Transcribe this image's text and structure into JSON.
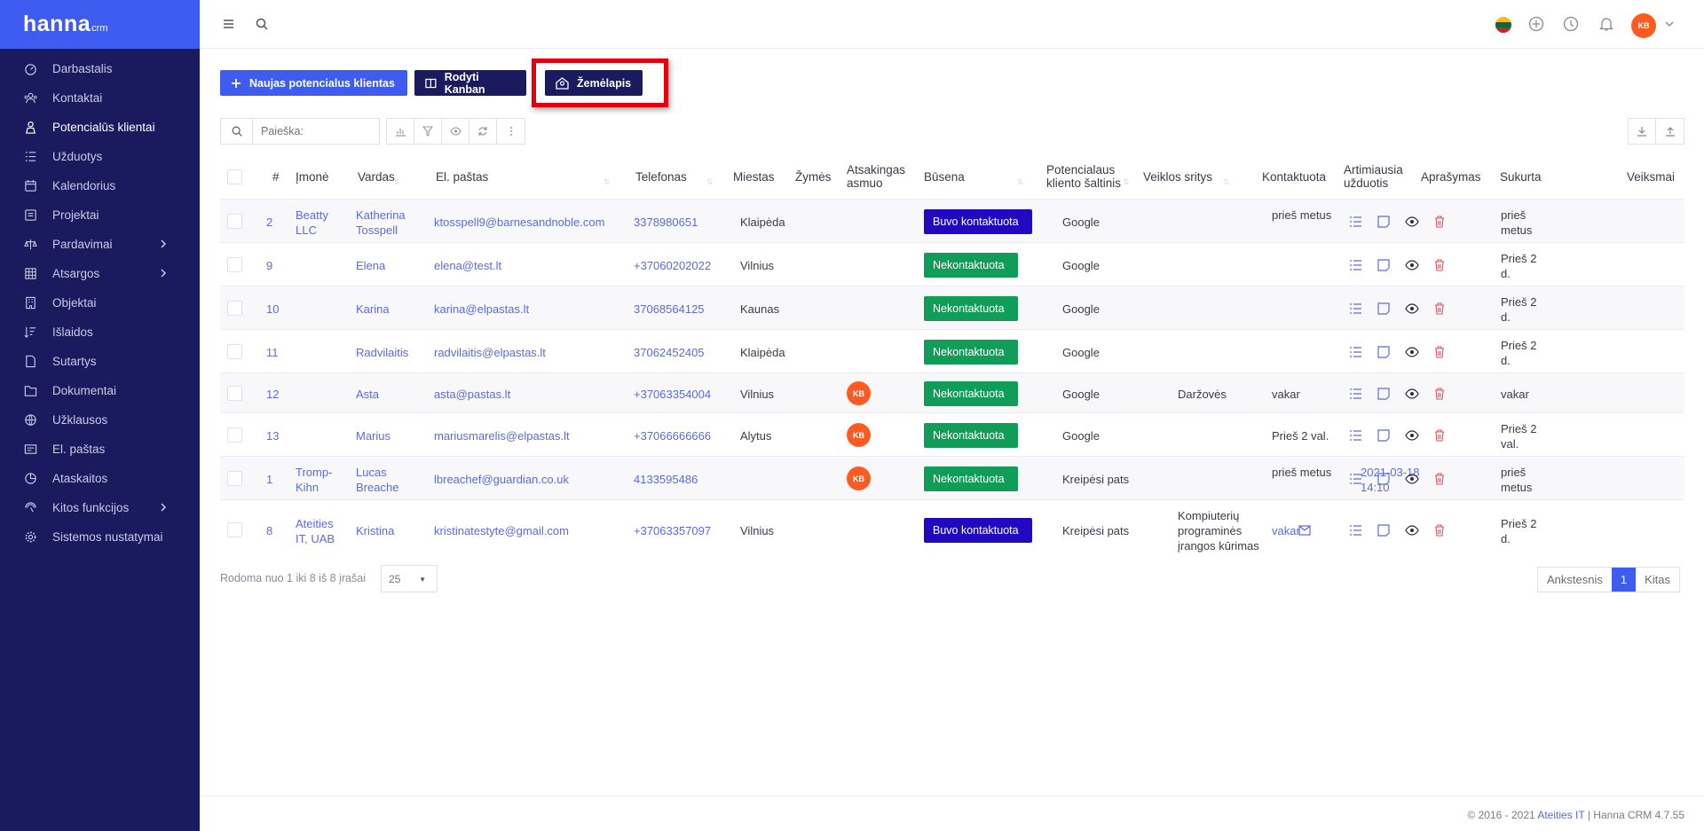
{
  "app": {
    "logo": "hanna",
    "logo_sub": "crm"
  },
  "sidebar": {
    "items": [
      {
        "label": "Darbastalis",
        "icon": "dashboard-icon"
      },
      {
        "label": "Kontaktai",
        "icon": "contacts-icon"
      },
      {
        "label": "Potencialūs klientai",
        "icon": "leads-icon",
        "active": true
      },
      {
        "label": "Užduotys",
        "icon": "tasks-icon"
      },
      {
        "label": "Kalendorius",
        "icon": "calendar-icon"
      },
      {
        "label": "Projektai",
        "icon": "projects-icon"
      },
      {
        "label": "Pardavimai",
        "icon": "sales-icon",
        "has_children": true
      },
      {
        "label": "Atsargos",
        "icon": "inventory-icon",
        "has_children": true
      },
      {
        "label": "Objektai",
        "icon": "objects-icon"
      },
      {
        "label": "Išlaidos",
        "icon": "expenses-icon"
      },
      {
        "label": "Sutartys",
        "icon": "contracts-icon"
      },
      {
        "label": "Dokumentai",
        "icon": "documents-icon"
      },
      {
        "label": "Užklausos",
        "icon": "inquiries-icon"
      },
      {
        "label": "El. paštas",
        "icon": "email-icon"
      },
      {
        "label": "Ataskaitos",
        "icon": "reports-icon"
      },
      {
        "label": "Kitos funkcijos",
        "icon": "other-icon",
        "has_children": true
      },
      {
        "label": "Sistemos nustatymai",
        "icon": "settings-icon"
      }
    ]
  },
  "topbar": {
    "user_initials": "KB",
    "language": "lt"
  },
  "toolbar": {
    "new_lead_label": "Naujas potencialus klientas",
    "kanban_label": "Rodyti Kanban",
    "map_label": "Žemėlapis"
  },
  "search": {
    "placeholder": "Paieška:"
  },
  "table": {
    "columns": [
      "#",
      "Įmonė",
      "Vardas",
      "El. paštas",
      "Telefonas",
      "Miestas",
      "Žymės",
      "Atsakingas asmuo",
      "Būsena",
      "Potencialaus kliento šaltinis",
      "Veiklos sritys",
      "Kontaktuota",
      "Artimiausia užduotis",
      "Aprašymas",
      "Sukurta",
      "Veiksmai"
    ],
    "rows": [
      {
        "num": "2",
        "company": "Beatty LLC",
        "name": "Katherina Tosspell",
        "email": "ktosspell9@barnesandnoble.com",
        "phone": "3378980651",
        "city": "Klaipėda",
        "owner": "",
        "status": "Buvo kontaktuota",
        "source": "Google",
        "activity": "",
        "contacted": "prieš metus",
        "next_task": "",
        "created": "prieš metus"
      },
      {
        "num": "9",
        "company": "",
        "name": "Elena",
        "email": "elena@test.lt",
        "phone": "+37060202022",
        "city": "Vilnius",
        "owner": "",
        "status": "Nekontaktuota",
        "source": "Google",
        "activity": "",
        "contacted": "",
        "next_task": "",
        "created": "Prieš 2 d."
      },
      {
        "num": "10",
        "company": "",
        "name": "Karina",
        "email": "karina@elpastas.lt",
        "phone": "37068564125",
        "city": "Kaunas",
        "owner": "",
        "status": "Nekontaktuota",
        "source": "Google",
        "activity": "",
        "contacted": "",
        "next_task": "",
        "created": "Prieš 2 d."
      },
      {
        "num": "11",
        "company": "",
        "name": "Radvilaitis",
        "email": "radvilaitis@elpastas.lt",
        "phone": "37062452405",
        "city": "Klaipėda",
        "owner": "",
        "status": "Nekontaktuota",
        "source": "Google",
        "activity": "",
        "contacted": "",
        "next_task": "",
        "created": "Prieš 2 d."
      },
      {
        "num": "12",
        "company": "",
        "name": "Asta",
        "email": "asta@pastas.lt",
        "phone": "+37063354004",
        "city": "Vilnius",
        "owner": "KB",
        "status": "Nekontaktuota",
        "source": "Google",
        "activity": "Daržovės",
        "contacted": "vakar",
        "next_task": "",
        "created": "vakar"
      },
      {
        "num": "13",
        "company": "",
        "name": "Marius",
        "email": "mariusmarelis@elpastas.lt",
        "phone": "+37066666666",
        "city": "Alytus",
        "owner": "KB",
        "status": "Nekontaktuota",
        "source": "Google",
        "activity": "",
        "contacted": "Prieš 2 val.",
        "next_task": "",
        "created": "Prieš 2 val."
      },
      {
        "num": "1",
        "company": "Tromp-Kihn",
        "name": "Lucas Breache",
        "email": "lbreachef@guardian.co.uk",
        "phone": "4133595486",
        "city": "",
        "owner": "KB",
        "status": "Nekontaktuota",
        "source": "Kreipėsi pats",
        "activity": "",
        "contacted": "prieš metus",
        "next_task": "2021-03-18 14:10",
        "created": "prieš metus"
      },
      {
        "num": "8",
        "company": "Ateities IT, UAB",
        "name": "Kristina",
        "email": "kristinatestyte@gmail.com",
        "phone": "+37063357097",
        "city": "Vilnius",
        "owner": "",
        "status": "Buvo kontaktuota",
        "source": "Kreipėsi pats",
        "activity": "Kompiuterių programinės įrangos kūrimas",
        "contacted": "vakar",
        "next_task": "",
        "created": "Prieš 2 d."
      }
    ]
  },
  "pagination": {
    "info": "Rodoma nuo 1 iki 8 iš 8 įrašai",
    "per_page": "25",
    "prev_label": "Ankstesnis",
    "current": "1",
    "next_label": "Kitas"
  },
  "footer": {
    "copyright_prefix": "© 2016 - 2021",
    "company": "Ateities IT",
    "suffix": "| Hanna CRM 4.7.55"
  },
  "colors": {
    "sidebar": "#1a1a5e",
    "accent": "#3e5cf0",
    "contacted": "#2109c2",
    "not_contacted": "#0f9d58",
    "avatar": "#ff5a1f",
    "highlight": "#e3000f"
  }
}
